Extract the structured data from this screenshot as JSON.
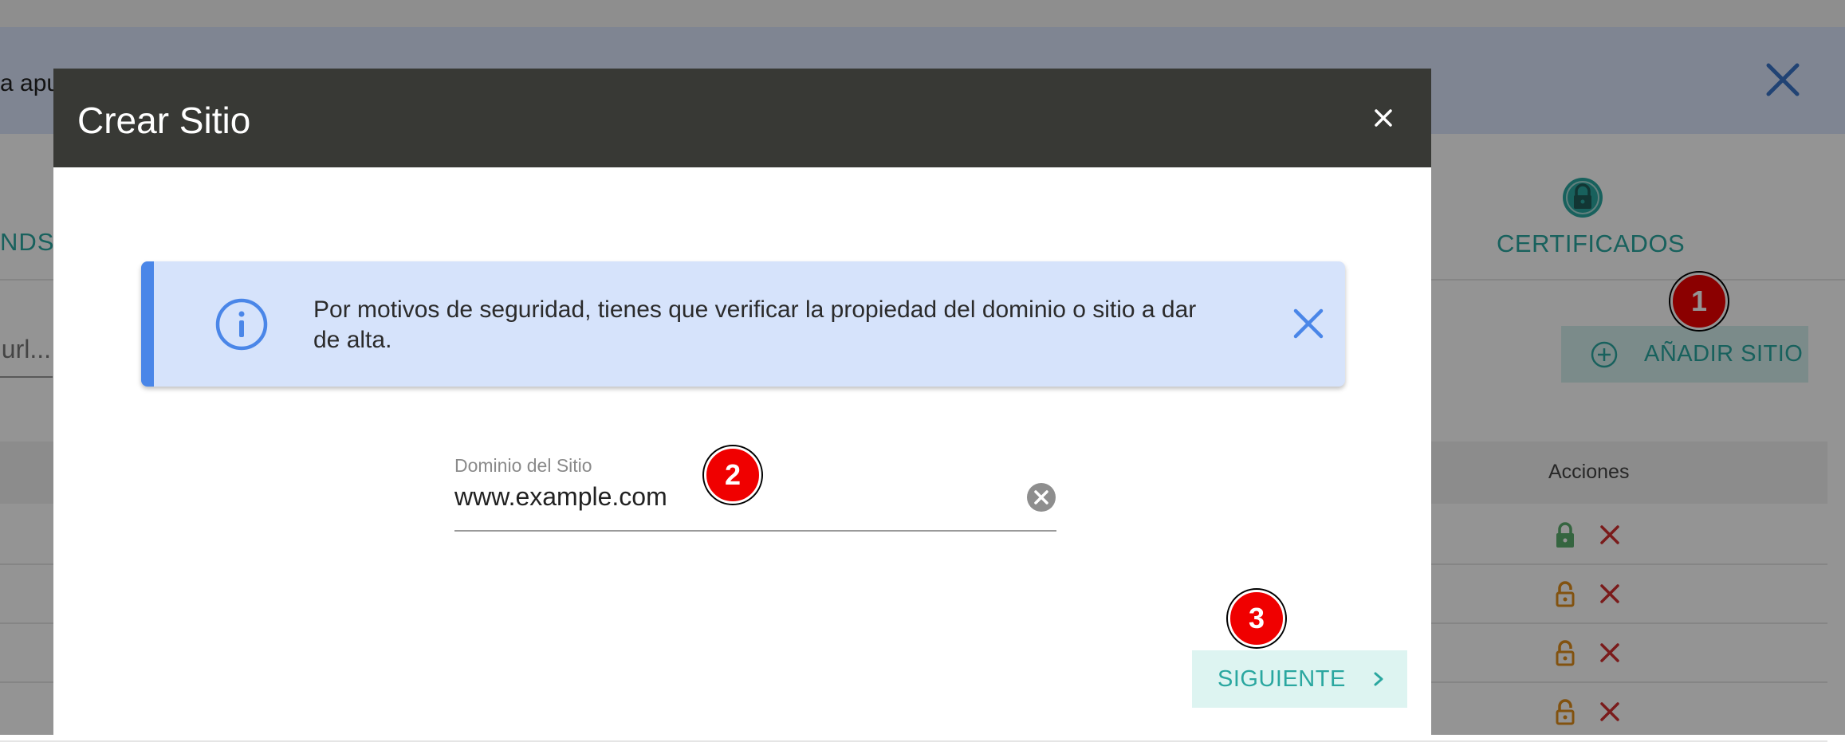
{
  "background": {
    "banner_text": "a apu",
    "tab_left_label": "NDS",
    "tab_certificates_label": "CERTIFICADOS",
    "search_placeholder": "url...",
    "add_site_label": "AÑADIR SITIO",
    "table_header_actions": "Acciones",
    "rows": [
      {
        "lock": "locked",
        "lock_color": "#5cae6e"
      },
      {
        "lock": "unlocked",
        "lock_color": "#e08e1a"
      },
      {
        "lock": "unlocked",
        "lock_color": "#e08e1a"
      },
      {
        "lock": "unlocked",
        "lock_color": "#e08e1a"
      }
    ]
  },
  "modal": {
    "title": "Crear Sitio",
    "info_message": "Por motivos de seguridad, tienes que verificar la propiedad del dominio o sitio a dar de alta.",
    "domain_label": "Dominio del Sitio",
    "domain_value": "www.example.com",
    "next_label": "SIGUIENTE"
  },
  "step_markers": [
    "1",
    "2",
    "3"
  ],
  "colors": {
    "accent_teal": "#2aa7a0",
    "info_blue": "#4a86e8",
    "header_dark": "#383935",
    "delete_red": "#d32f2f",
    "step_red": "#f00000"
  },
  "icons": {
    "banner_close": "close-icon",
    "certificates": "padlock-icon",
    "add_site": "plus-circle-icon",
    "modal_close": "close-icon",
    "info": "info-icon",
    "info_close": "close-icon",
    "clear_field": "clear-circle-icon",
    "next": "chevron-right-icon"
  }
}
